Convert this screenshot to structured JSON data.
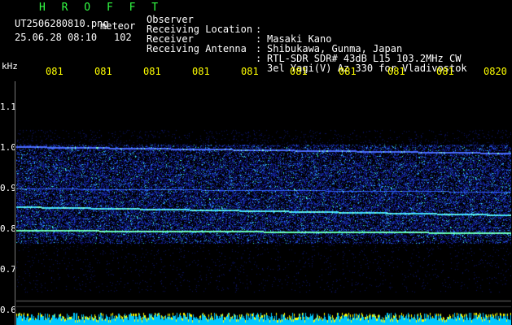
{
  "header": {
    "title": "H R O F F T",
    "filename": "UT2506280810.png",
    "kind": "meteor",
    "datetime": "25.06.28 08:10",
    "count": "102",
    "rows": [
      {
        "label": "Observer",
        "value": "Masaki Kano"
      },
      {
        "label": "Receiving Location",
        "value": "Shibukawa, Gunma, Japan"
      },
      {
        "label": "Receiver",
        "value": "RTL-SDR SDR# 43dB L15 103.2MHz CW"
      },
      {
        "label": "Receiving Antenna",
        "value": "3el Yagi(V) Az 330 for Vladivostok"
      }
    ]
  },
  "axis": {
    "unit": "kHz",
    "y_ticks": [
      "1.1",
      "1.0",
      "0.9",
      "0.8",
      "0.7",
      "0.6"
    ],
    "x_ticks": [
      "081",
      "081",
      "081",
      "081",
      "081",
      "081",
      "081",
      "081",
      "081",
      "0820"
    ]
  },
  "colors": {
    "title": "#33ff44",
    "ticks": "#ffff00",
    "text": "#ffffff",
    "noise": "#1a2aa0",
    "bottom_bar_a": "#00c8ff",
    "bottom_bar_b": "#ffff00"
  }
}
